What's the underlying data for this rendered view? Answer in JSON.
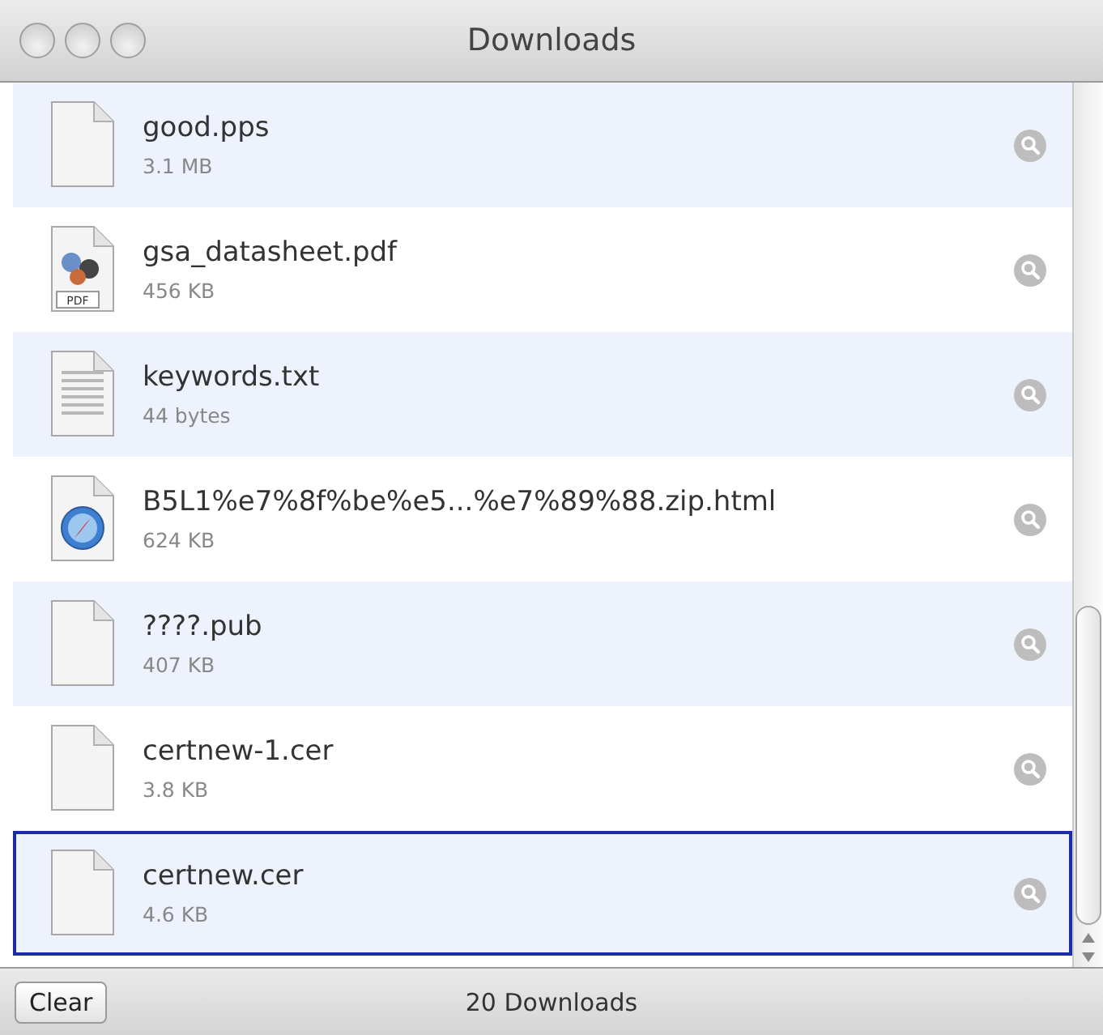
{
  "window": {
    "title": "Downloads"
  },
  "downloads": [
    {
      "name": "good.pps",
      "size": "3.1 MB",
      "kind": "blank",
      "selected": false
    },
    {
      "name": "gsa_datasheet.pdf",
      "size": "456 KB",
      "kind": "pdf",
      "icon_label": "PDF",
      "selected": false
    },
    {
      "name": "keywords.txt",
      "size": "44 bytes",
      "kind": "text",
      "selected": false
    },
    {
      "name": "B5L1%e7%8f%be%e5...%e7%89%88.zip.html",
      "size": "624 KB",
      "kind": "web",
      "selected": false
    },
    {
      "name": "????.pub",
      "size": "407 KB",
      "kind": "blank",
      "selected": false
    },
    {
      "name": "certnew-1.cer",
      "size": "3.8 KB",
      "kind": "blank",
      "selected": false
    },
    {
      "name": "certnew.cer",
      "size": "4.6 KB",
      "kind": "blank",
      "selected": true
    }
  ],
  "footer": {
    "button": "Clear",
    "count": "20 Downloads"
  }
}
